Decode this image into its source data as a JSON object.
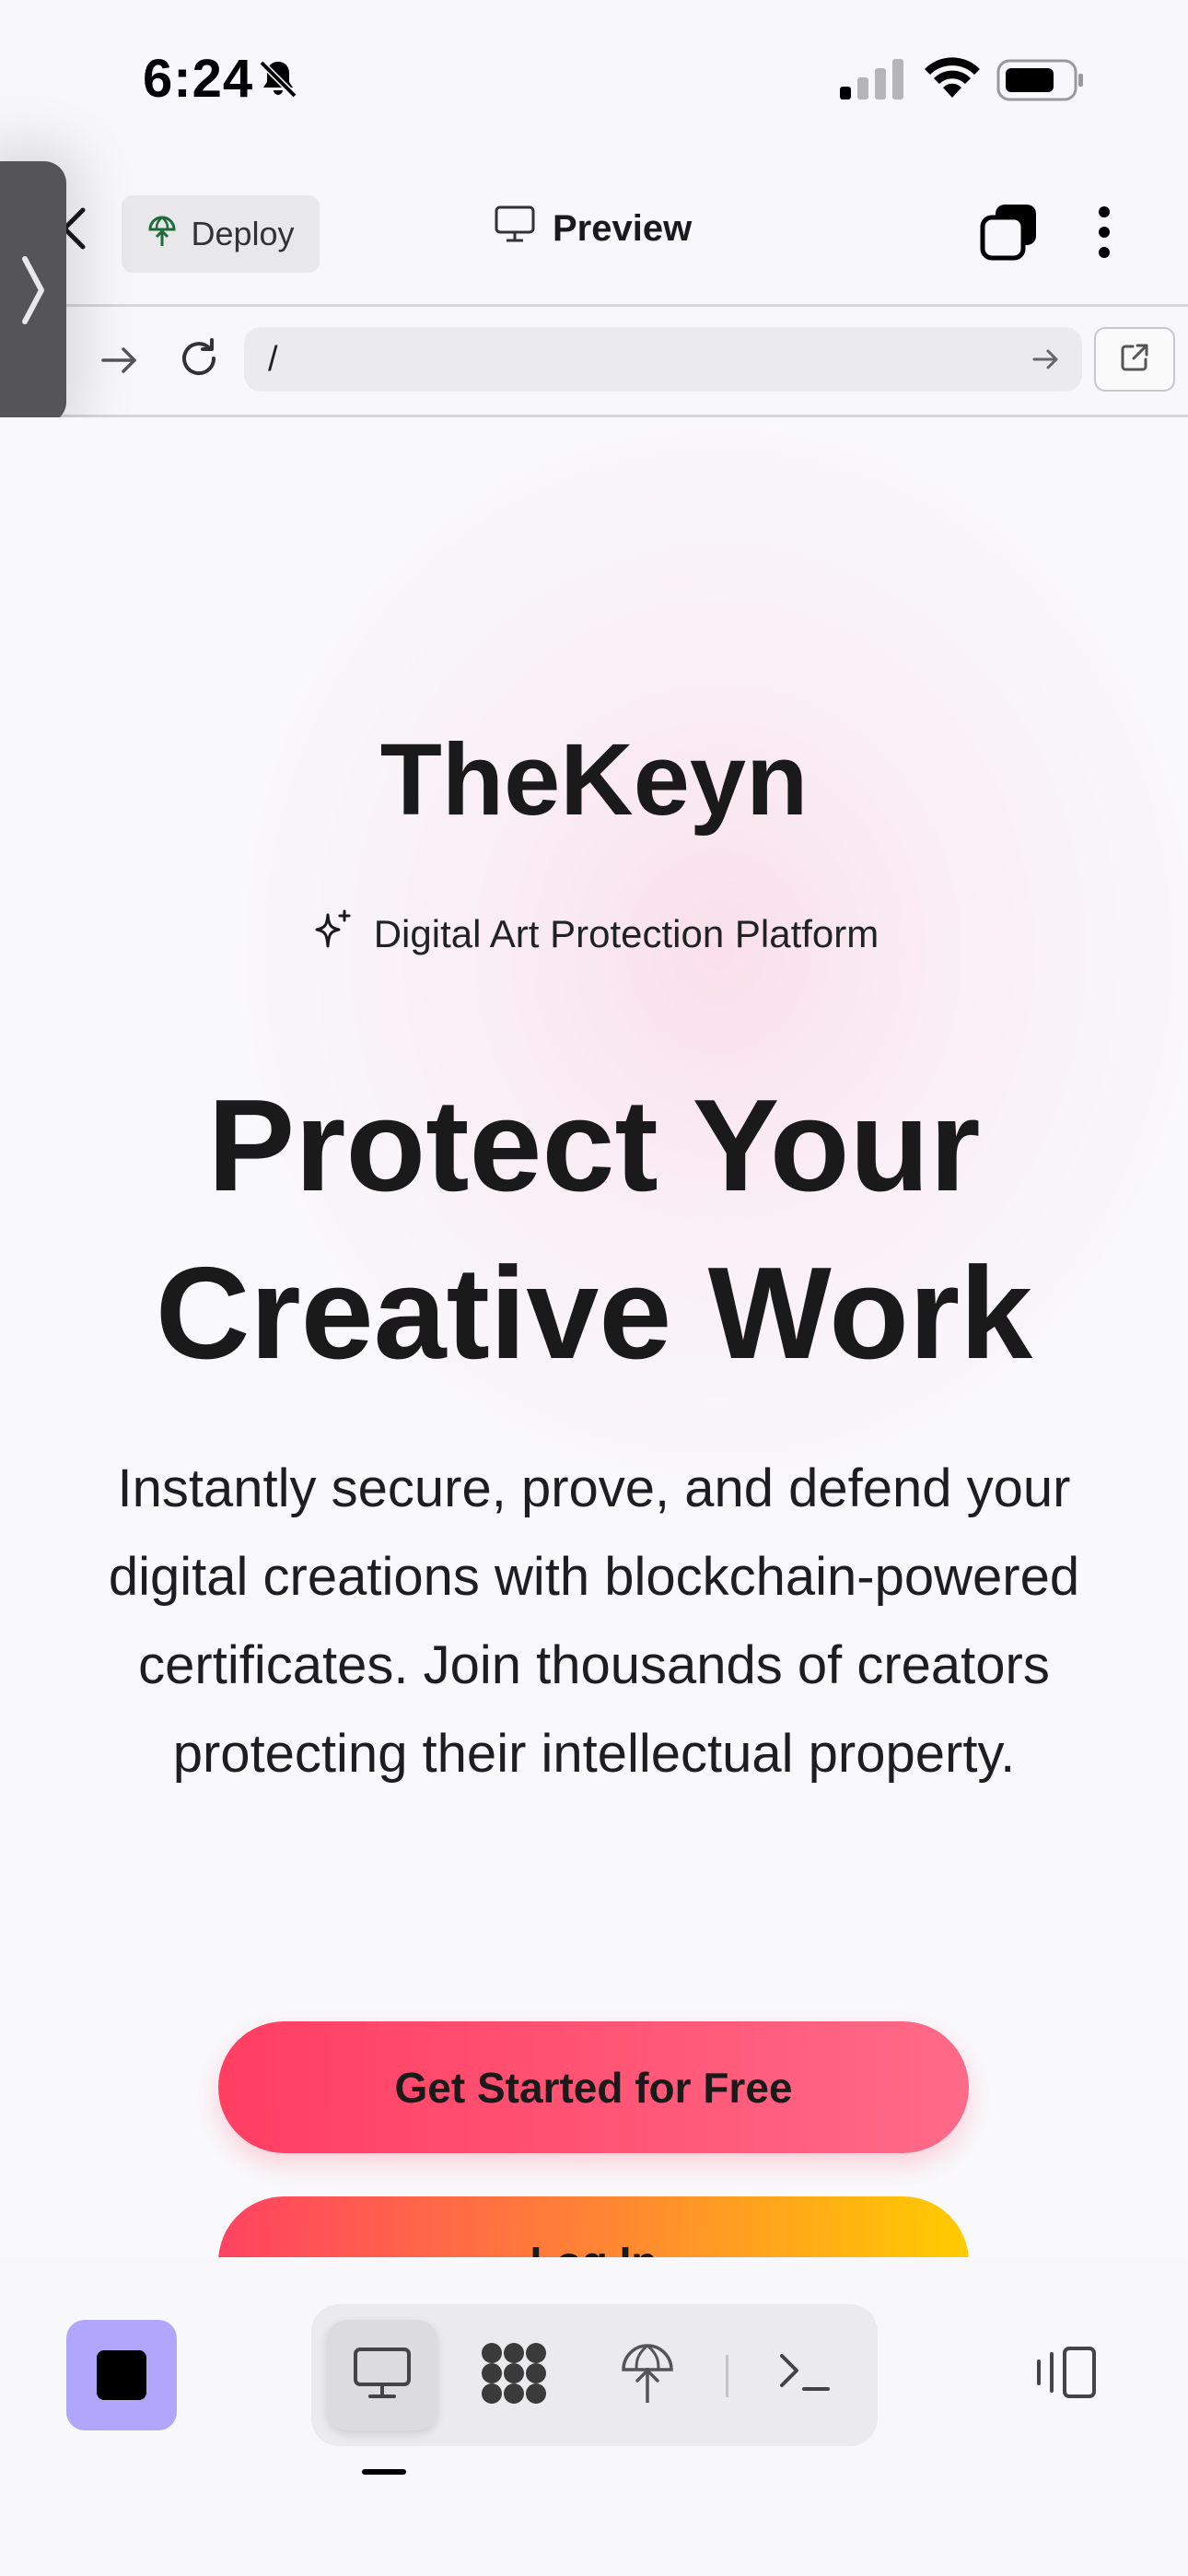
{
  "status_bar": {
    "time": "6:24"
  },
  "top_bar": {
    "deploy_label": "Deploy",
    "preview_label": "Preview"
  },
  "url_bar": {
    "url_value": "/"
  },
  "hero": {
    "brand": "TheKeyn",
    "tagline": "Digital Art Protection Platform",
    "headline_line1": "Protect Your",
    "headline_line2": "Creative Work",
    "subtitle": "Instantly secure, prove, and defend your digital creations with blockchain-powered certificates. Join thousands of creators protecting their intellectual property.",
    "primary_cta": "Get Started for Free",
    "secondary_cta": "Log In"
  },
  "icons": {
    "bell": "bell-slash-icon",
    "back": "chevron-left-icon",
    "deploy": "globe-upload-icon",
    "preview": "monitor-icon",
    "tabs": "tabs-icon",
    "more": "more-vertical-icon",
    "forward": "arrow-right-icon",
    "reload": "reload-icon",
    "open_external": "external-link-icon",
    "sparkle": "sparkle-icon",
    "stop": "stop-icon",
    "console": "terminal-icon",
    "panel": "panel-switch-icon"
  },
  "colors": {
    "accent_purple": "#b1a6fb",
    "cta_pink": "#ff3e62",
    "cta_pink_light": "#ff6a88",
    "login_gradient_orange": "#ff8a30",
    "login_gradient_yellow": "#ffcc00"
  }
}
